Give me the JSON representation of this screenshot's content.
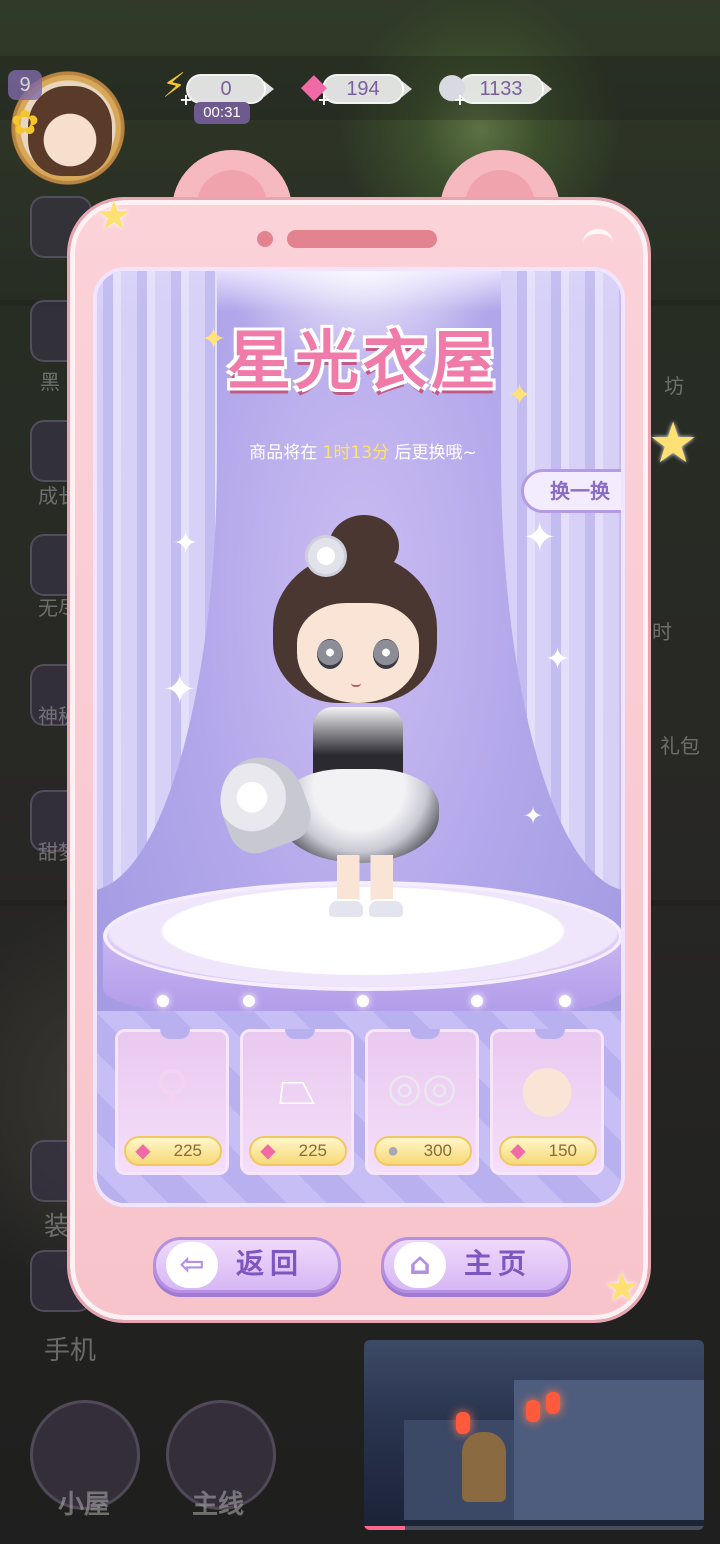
{
  "hud": {
    "level": "9",
    "energy": "0",
    "energy_timer": "00:31",
    "gems": "194",
    "coins": "1133"
  },
  "background": {
    "side_labels": [
      "黑",
      "成长",
      "无尽",
      "神秘",
      "甜梦",
      "装",
      "手机"
    ],
    "right_labels": [
      "坊",
      "时",
      "礼包"
    ],
    "bottom_nav": [
      {
        "label": "小屋",
        "icon": "house-icon"
      },
      {
        "label": "主线",
        "icon": "book-icon"
      }
    ]
  },
  "shop": {
    "title": "星光衣屋",
    "subtitle_prefix": "商品将在",
    "subtitle_time": "1时13分",
    "subtitle_suffix": "后更换哦~",
    "refresh_label": "换一换"
  },
  "items": [
    {
      "name": "long-hair-wig",
      "price": "225",
      "currency": "gem",
      "icon": "hair-icon"
    },
    {
      "name": "white-skirt",
      "price": "225",
      "currency": "gem",
      "icon": "skirt-icon"
    },
    {
      "name": "silver-bracelets",
      "price": "300",
      "currency": "coin",
      "icon": "bracelet-icon"
    },
    {
      "name": "glasses",
      "price": "150",
      "currency": "gem",
      "icon": "glasses-icon"
    }
  ],
  "buttons": {
    "back_label": "返回",
    "home_label": "主页"
  },
  "video": {
    "progress": 0.12
  },
  "colors": {
    "phone_pink": "#f8c4cc",
    "screen_purple": "#b2a7ea",
    "title_pink": "#f07aa8",
    "button_purple": "#7f55c0",
    "price_gold": "#f7d977"
  }
}
